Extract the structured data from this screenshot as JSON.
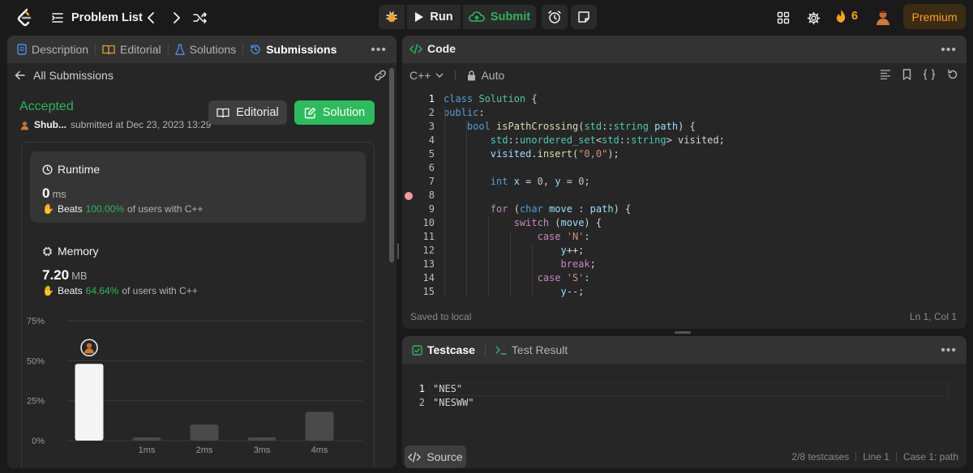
{
  "topbar": {
    "problem_list": "Problem List",
    "run_label": "Run",
    "submit_label": "Submit",
    "streak_count": "6",
    "premium_label": "Premium"
  },
  "left_panel": {
    "tabs": [
      {
        "label": "Description"
      },
      {
        "label": "Editorial"
      },
      {
        "label": "Solutions"
      },
      {
        "label": "Submissions"
      }
    ],
    "all_submissions": "All Submissions",
    "status": "Accepted",
    "user": "Shub...",
    "submitted": "submitted at Dec 23, 2023 13:29",
    "editorial_button": "Editorial",
    "solution_button": "Solution",
    "runtime": {
      "title": "Runtime",
      "value": "0",
      "unit": "ms",
      "beats_word": "Beats",
      "beats_pct": "100.00%",
      "beats_suffix": "of users with C++"
    },
    "memory": {
      "title": "Memory",
      "value": "7.20",
      "unit": "MB",
      "beats_word": "Beats",
      "beats_pct": "64.64%",
      "beats_suffix": "of users with C++"
    }
  },
  "chart_data": {
    "type": "bar",
    "categories": [
      "0ms",
      "1ms",
      "2ms",
      "3ms",
      "4ms"
    ],
    "tick_labels": [
      "",
      "1ms",
      "2ms",
      "3ms",
      "4ms"
    ],
    "values": [
      48,
      2,
      10,
      2,
      18
    ],
    "highlight_index": 0,
    "yticks": [
      "0%",
      "25%",
      "50%",
      "75%"
    ],
    "ylim": [
      0,
      75
    ],
    "colors": {
      "highlight": "#f5f5f5",
      "other": "#4a4a4a",
      "grid": "#3a3a3a"
    }
  },
  "code_panel": {
    "title": "Code",
    "language": "C++",
    "mode": "Auto",
    "saved": "Saved to local",
    "cursor": "Ln 1, Col 1",
    "lines": [
      "1",
      "2",
      "3",
      "4",
      "5",
      "6",
      "7",
      "8",
      "9",
      "10",
      "11",
      "12",
      "13",
      "14",
      "15"
    ]
  },
  "test_panel": {
    "tab_testcase": "Testcase",
    "tab_result": "Test Result",
    "cases": [
      "\"NES\"",
      "\"NESWW\""
    ],
    "case_numbers": [
      "1",
      "2"
    ],
    "source_button": "Source",
    "status_testcases": "2/8 testcases",
    "status_line": "Line 1",
    "status_case": "Case 1: path"
  },
  "colors": {
    "accent_green": "#2db55d",
    "accent_orange": "#ffa116",
    "panel_bg": "#262626",
    "page_bg": "#1a1a1a"
  }
}
